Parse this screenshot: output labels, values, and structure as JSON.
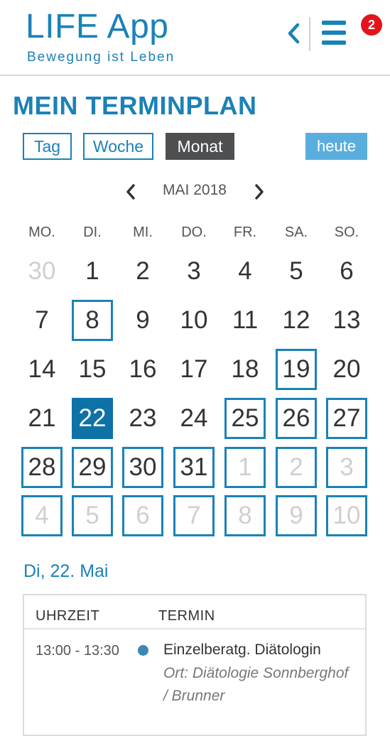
{
  "header": {
    "app_title": "LIFE App",
    "tagline": "Bewegung ist Leben",
    "notification_count": "2",
    "colors": {
      "brand": "#1a82b8",
      "badge": "#e3141c"
    },
    "icons": [
      "chevron-left-icon",
      "hamburger-menu-icon"
    ]
  },
  "page_title": "MEIN TERMINPLAN",
  "views": {
    "day": "Tag",
    "week": "Woche",
    "month": "Monat",
    "active": "Monat",
    "today": "heute"
  },
  "calendar": {
    "month_label": "MAI 2018",
    "weekdays": [
      "MO.",
      "DI.",
      "MI.",
      "DO.",
      "FR.",
      "SA.",
      "SO."
    ],
    "weeks": [
      [
        "30",
        "1",
        "2",
        "3",
        "4",
        "5",
        "6"
      ],
      [
        "7",
        "8",
        "9",
        "10",
        "11",
        "12",
        "13"
      ],
      [
        "14",
        "15",
        "16",
        "17",
        "18",
        "19",
        "20"
      ],
      [
        "21",
        "22",
        "23",
        "24",
        "25",
        "26",
        "27"
      ],
      [
        "28",
        "29",
        "30",
        "31",
        "1",
        "2",
        "3"
      ],
      [
        "4",
        "5",
        "6",
        "7",
        "8",
        "9",
        "10"
      ]
    ],
    "selected_date": "22",
    "event_days_in_month": [
      "8",
      "19",
      "25",
      "26",
      "27",
      "28",
      "29",
      "30",
      "31"
    ],
    "event_days_next_month": [
      "1",
      "2",
      "3",
      "4",
      "5",
      "6",
      "7",
      "8",
      "9",
      "10"
    ]
  },
  "selected_day": {
    "heading": "Di, 22. Mai",
    "columns": {
      "time": "UHRZEIT",
      "appointment": "TERMIN"
    },
    "appointments": [
      {
        "time": "13:00 - 13:30",
        "title": "Einzelberatg. Diätologin",
        "location": "Ort: Diätologie Sonnberghof / Brunner"
      }
    ]
  }
}
